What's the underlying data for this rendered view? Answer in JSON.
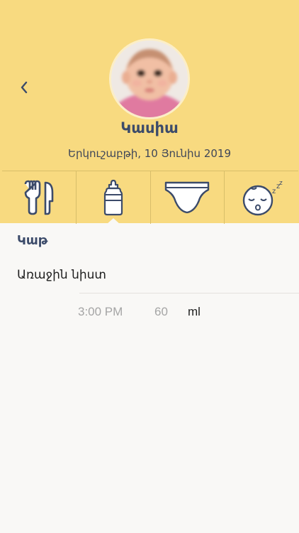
{
  "profile": {
    "name": "Կասիա",
    "date": "Երկուշաբթի, 10 Յունիս 2019"
  },
  "tabs": [
    {
      "icon": "utensils-icon"
    },
    {
      "icon": "baby-bottle-icon",
      "selected": true
    },
    {
      "icon": "diaper-icon"
    },
    {
      "icon": "sleeping-baby-icon"
    }
  ],
  "section": {
    "title": "Կաթ"
  },
  "entry": {
    "food": "Առաջին նիստ",
    "time": "3:00 PM",
    "amount": "60",
    "unit": "ml"
  },
  "colors": {
    "header": "#f8da80",
    "accent": "#3c4b6a",
    "background": "#f9f8f6"
  }
}
